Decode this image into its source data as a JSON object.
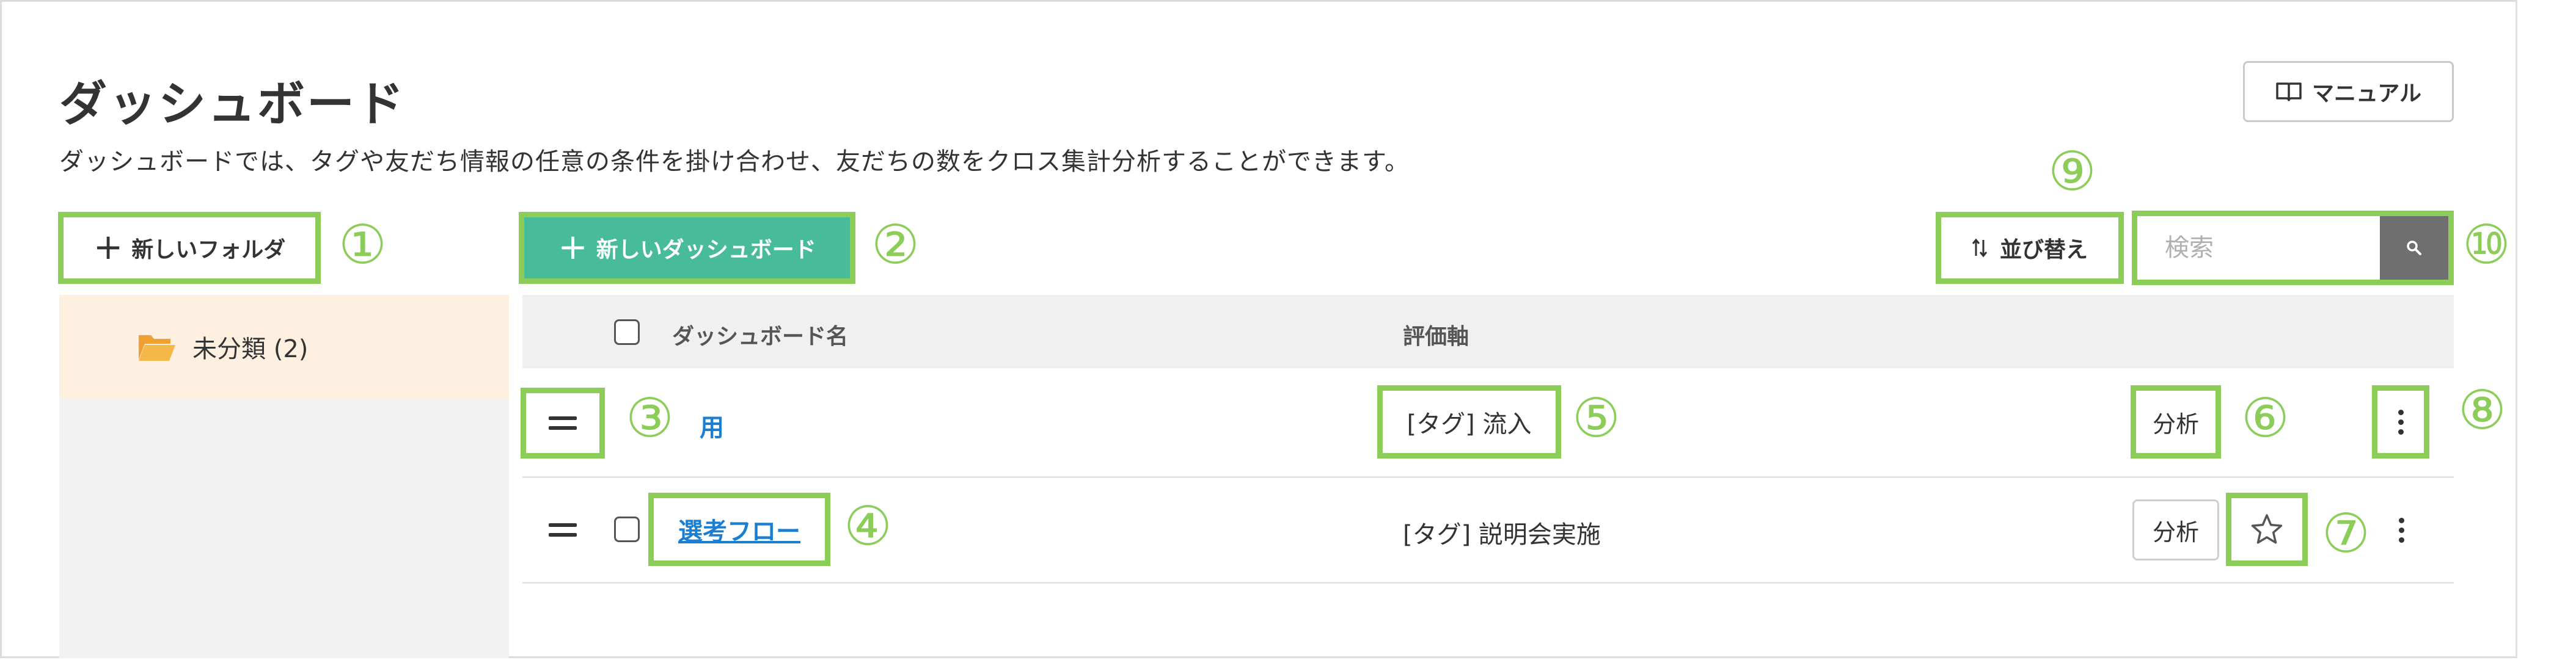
{
  "header": {
    "title": "ダッシュボード",
    "description": "ダッシュボードでは、タグや友だち情報の任意の条件を掛け合わせ、友だちの数をクロス集計分析することができます。",
    "manual_label": "マニュアル"
  },
  "toolbar": {
    "new_folder_label": "新しいフォルダ",
    "new_dashboard_label": "新しいダッシュボード",
    "sort_label": "並び替え",
    "search_placeholder": "検索"
  },
  "sidebar": {
    "folders": [
      {
        "label": "未分類 (2)",
        "icon": "folder-open-icon",
        "color": "#f0a030"
      }
    ]
  },
  "table": {
    "columns": [
      "ダッシュボード名",
      "評価軸"
    ],
    "rows": [
      {
        "name": "用",
        "axis": "[タグ] 流入",
        "analyze_label": "分析"
      },
      {
        "name": "選考フロー",
        "axis": "[タグ] 説明会実施",
        "analyze_label": "分析"
      }
    ]
  },
  "annotations": [
    "①",
    "②",
    "③",
    "④",
    "⑤",
    "⑥",
    "⑦",
    "⑧",
    "⑨",
    "⑩"
  ],
  "colors": {
    "primary_green": "#48bc99",
    "highlight": "#8ccd5a",
    "link": "#1a7fd2",
    "folder": "#f0a030",
    "selected_folder_bg": "#fdf0e0"
  }
}
